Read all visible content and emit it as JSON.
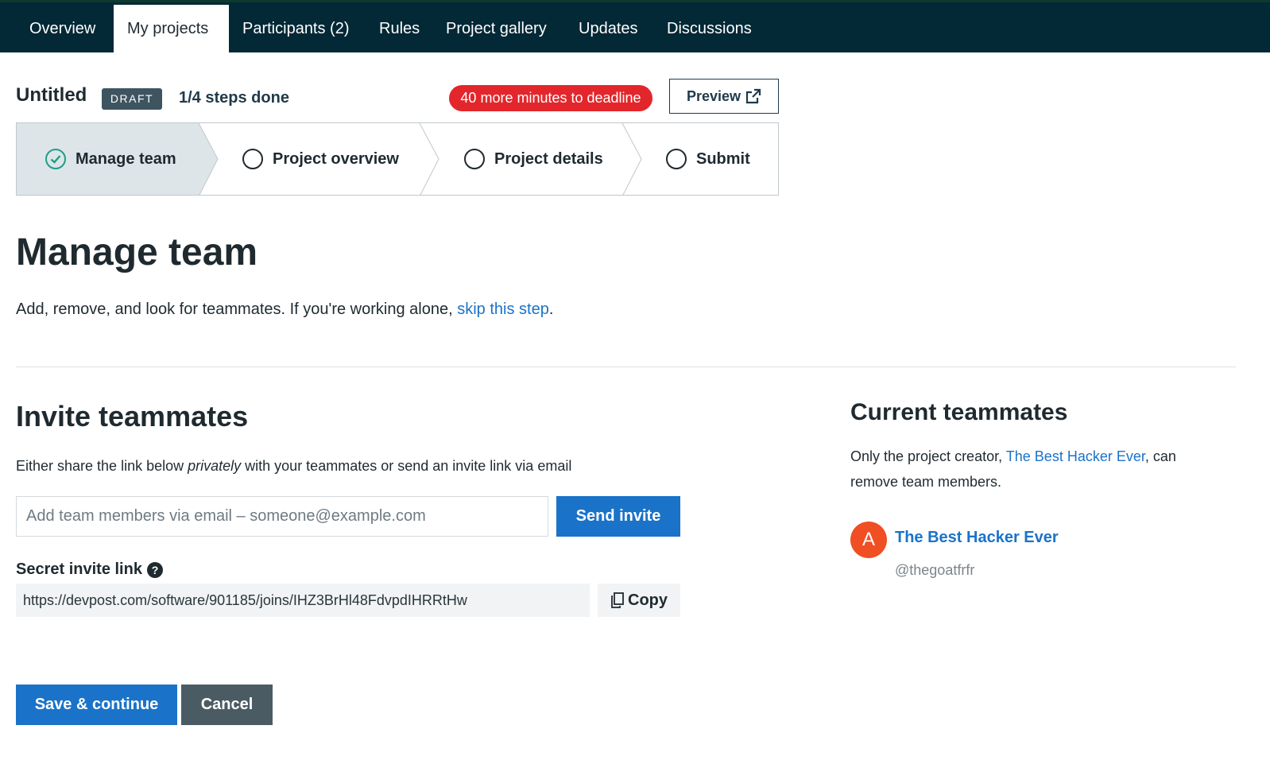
{
  "nav": {
    "tabs": [
      {
        "label": "Overview"
      },
      {
        "label": "My projects"
      },
      {
        "label": "Participants (2)"
      },
      {
        "label": "Rules"
      },
      {
        "label": "Project gallery"
      },
      {
        "label": "Updates"
      },
      {
        "label": "Discussions"
      }
    ],
    "active_tab": "My projects"
  },
  "header": {
    "title": "Untitled",
    "badge": "DRAFT",
    "steps_done": "1/4 steps done",
    "deadline": "40 more minutes to deadline",
    "preview_label": "Preview"
  },
  "stepper": {
    "steps": [
      {
        "label": "Manage team",
        "status": "done"
      },
      {
        "label": "Project overview",
        "status": "todo"
      },
      {
        "label": "Project details",
        "status": "todo"
      },
      {
        "label": "Submit",
        "status": "todo"
      }
    ]
  },
  "main": {
    "heading": "Manage team",
    "intro_text": "Add, remove, and look for teammates. If you're working alone, ",
    "intro_link": "skip this step",
    "intro_end": "."
  },
  "invite": {
    "heading": "Invite teammates",
    "share_pre": "Either share the link below ",
    "share_em": "privately",
    "share_post": " with your teammates or send an invite link via email",
    "email_placeholder": "Add team members via email – someone@example.com",
    "email_value": "",
    "send_label": "Send invite",
    "secret_label": "Secret invite link",
    "help_glyph": "?",
    "invite_url": "https://devpost.com/software/901185/joins/IHZ3BrHl48FdvpdIHRRtHw",
    "copy_label": "Copy"
  },
  "actions": {
    "save_label": "Save & continue",
    "cancel_label": "Cancel"
  },
  "teammates": {
    "heading": "Current teammates",
    "note_pre": "Only the project creator, ",
    "note_link": "The Best Hacker Ever",
    "note_post": ", can remove team members.",
    "members": [
      {
        "initial": "A",
        "name": "The Best Hacker Ever",
        "handle": "@thegoatfrfr"
      }
    ]
  },
  "colors": {
    "nav_bg": "#032836",
    "accent_blue": "#1a73c9",
    "deadline_red": "#e3262c",
    "avatar_orange": "#f04e23",
    "check_teal": "#1e9e89",
    "cancel_gray": "#4a5b63"
  },
  "icons": {
    "preview": "external-link-icon",
    "step_done": "check-circle-icon",
    "step_todo": "empty-circle-icon",
    "help": "question-circle-icon",
    "copy": "clipboard-copy-icon"
  }
}
